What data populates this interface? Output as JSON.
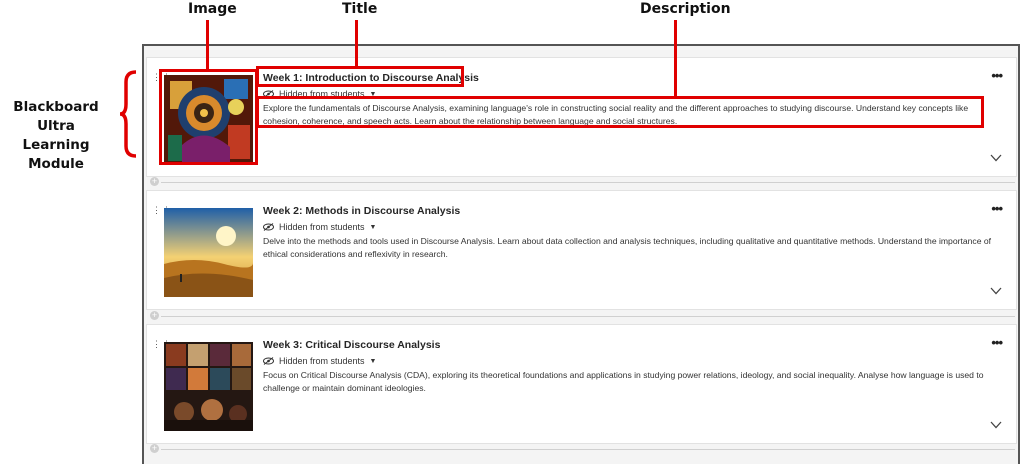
{
  "annotations": {
    "image": "Image",
    "title": "Title",
    "description": "Description",
    "module_line1": "Blackboard Ultra",
    "module_line2": "Learning Module"
  },
  "colors": {
    "annotation": "#e00000"
  },
  "modules": [
    {
      "title": "Week 1: Introduction to Discourse Analysis",
      "visibility": "Hidden from students",
      "description": "Explore the fundamentals of Discourse Analysis, examining language's role in constructing social reality and the different approaches to studying discourse. Understand key concepts like cohesion, coherence, and speech acts. Learn about the relationship between language and social structures.",
      "more_label": "•••"
    },
    {
      "title": "Week 2: Methods in Discourse Analysis",
      "visibility": "Hidden from students",
      "description": "Delve into the methods and tools used in Discourse Analysis. Learn about data collection and analysis techniques, including qualitative and quantitative methods. Understand the importance of ethical considerations and reflexivity in research.",
      "more_label": "•••"
    },
    {
      "title": "Week 3: Critical Discourse Analysis",
      "visibility": "Hidden from students",
      "description": "Focus on Critical Discourse Analysis (CDA), exploring its theoretical foundations and applications in studying power relations, ideology, and social inequality. Analyse how language is used to challenge or maintain dominant ideologies.",
      "more_label": "•••"
    }
  ]
}
